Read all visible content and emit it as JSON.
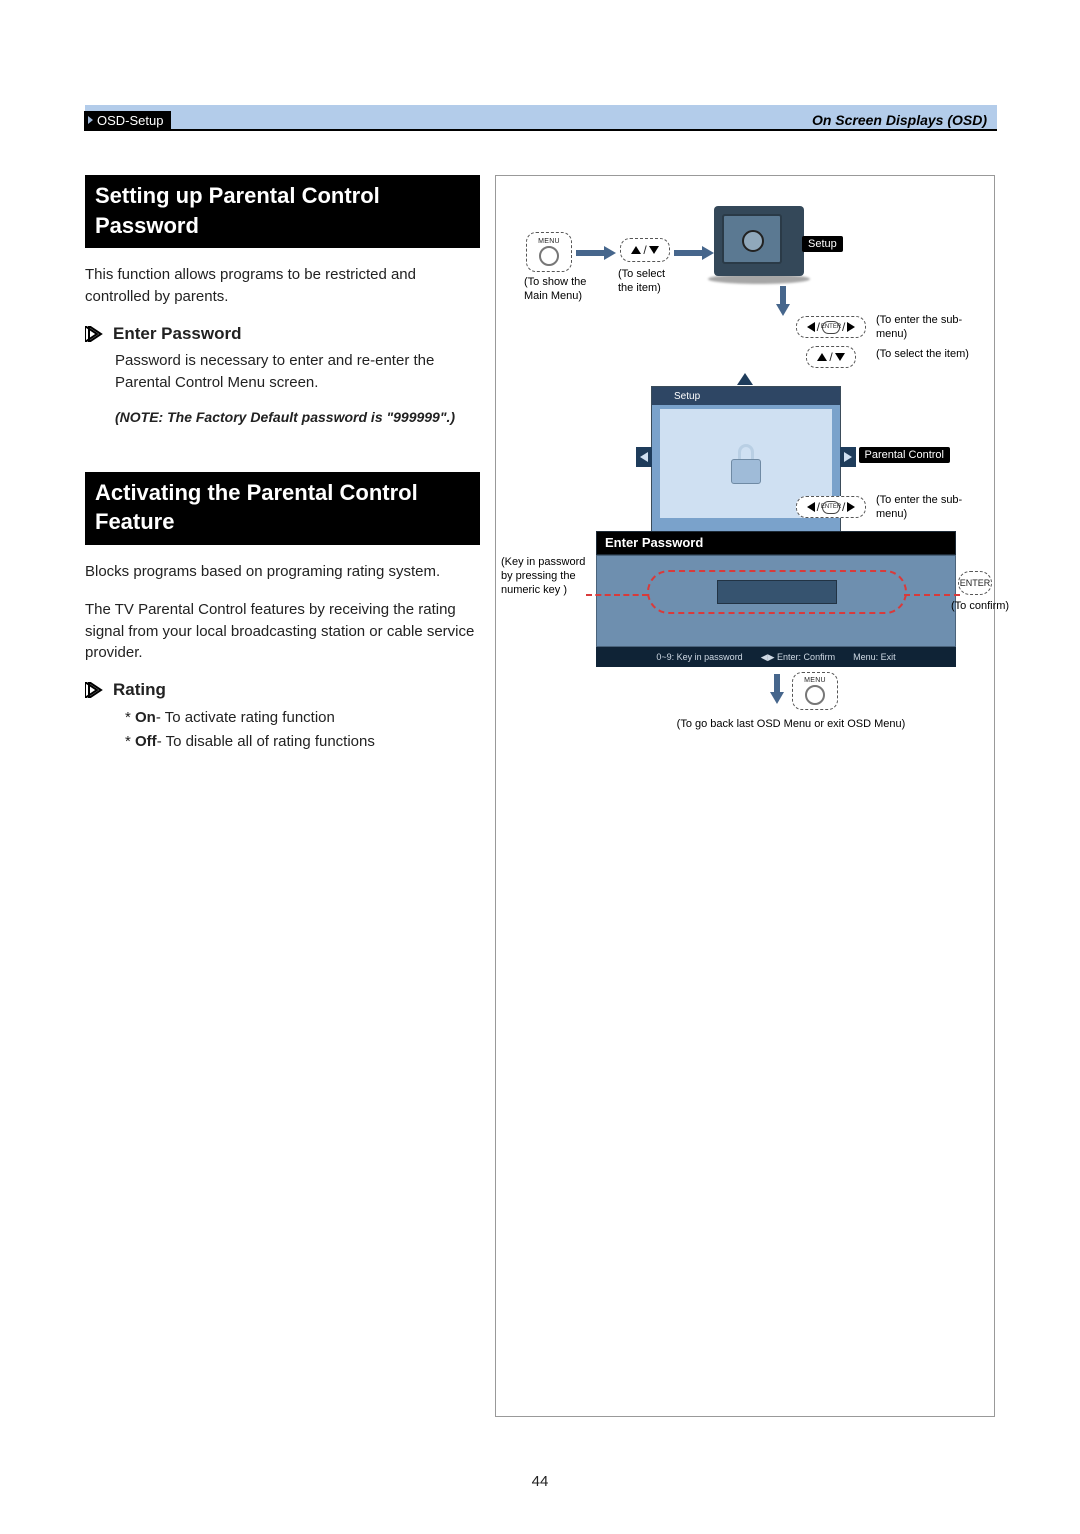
{
  "header": {
    "breadcrumb": "OSD-Setup",
    "section": "On Screen Displays (OSD)"
  },
  "block1": {
    "title": "Setting up Parental Control Password",
    "intro": "This function allows programs to be restricted and controlled by parents.",
    "sub_title": "Enter Password",
    "sub_body": "Password is necessary to enter and re-enter the Parental Control Menu screen.",
    "note": "(NOTE: The Factory Default password is \"999999\".)"
  },
  "block2": {
    "title": "Activating the Parental Control Feature",
    "p1": "Blocks programs based on programing rating system.",
    "p2": "The TV Parental Control features by receiving the rating signal from your local broadcasting station or cable service provider.",
    "sub_title": "Rating",
    "opt_on_lead": "On",
    "opt_on_rest": "- To activate rating function",
    "opt_off_lead": "Off",
    "opt_off_rest": "- To disable all of rating functions"
  },
  "figure": {
    "menu_label": "MENU",
    "enter_label": "ENTER",
    "cap_show_main": "(To show the Main Menu)",
    "cap_select_item": "(To select the item)",
    "safe_setup": "Setup",
    "cap_enter_sub": "(To enter the sub-menu)",
    "cap_select_item2": "(To select the item)",
    "panel_setup_title": "Setup",
    "panel_pc_label": "Parental Control",
    "cap_enter_sub2": "(To enter the sub-menu)",
    "pw_title": "Enter Password",
    "cap_keyin": "(Key in password by pressing the numeric key )",
    "cap_confirm": "(To confirm)",
    "hint1": "0~9: Key in password",
    "hint2": "◀▶ Enter: Confirm",
    "hint3": "Menu: Exit",
    "cap_goback": "(To go back last OSD Menu or exit OSD Menu)"
  },
  "page_number": "44"
}
